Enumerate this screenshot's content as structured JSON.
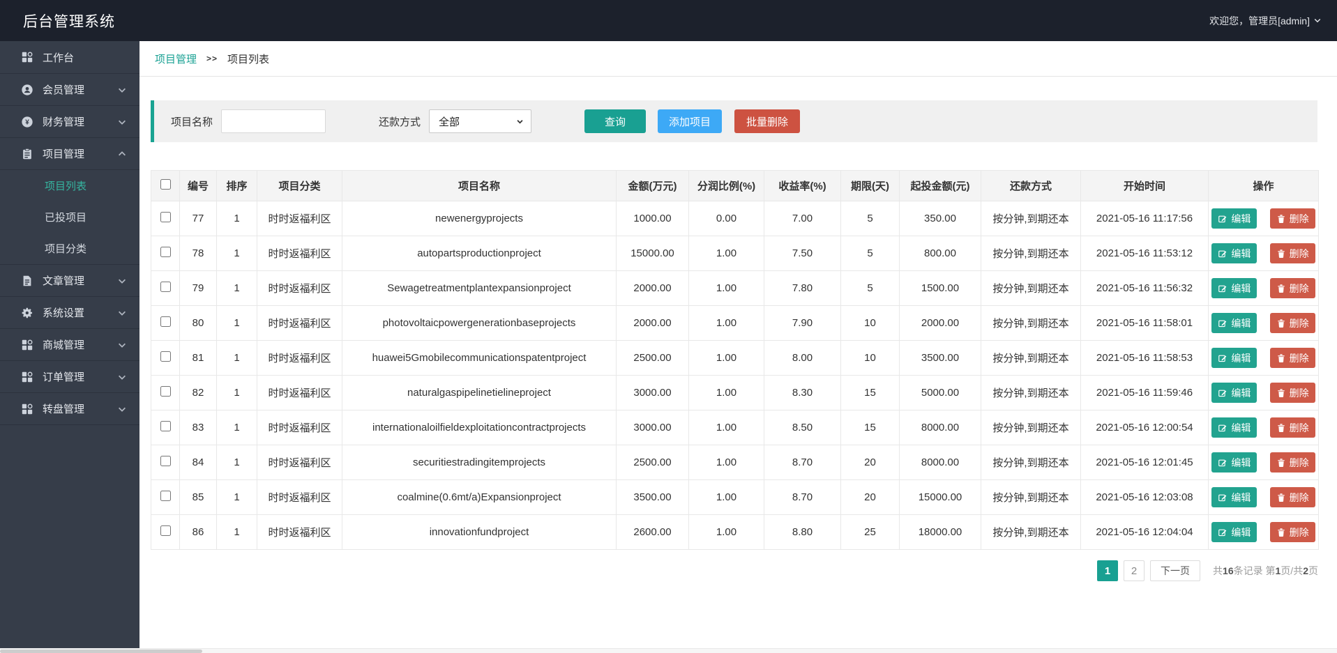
{
  "app": {
    "title": "后台管理系统",
    "welcome": "欢迎您，管理员[admin]"
  },
  "colors": {
    "accent_teal": "#19a092",
    "button_blue": "#3da9f6",
    "button_red": "#cd5241",
    "edit_teal": "#22a38f",
    "delete_red": "#ce5a48",
    "topbar": "#1c212c",
    "sidebar": "#363d49",
    "active_menu": "#35b5a0"
  },
  "sidebar": {
    "items": [
      {
        "label": "工作台",
        "icon": "dashboard-icon"
      },
      {
        "label": "会员管理",
        "icon": "member-icon"
      },
      {
        "label": "财务管理",
        "icon": "finance-icon"
      },
      {
        "label": "项目管理",
        "icon": "project-icon",
        "expanded": true,
        "children": [
          {
            "label": "项目列表",
            "active": true
          },
          {
            "label": "已投项目"
          },
          {
            "label": "项目分类"
          }
        ]
      },
      {
        "label": "文章管理",
        "icon": "article-icon"
      },
      {
        "label": "系统设置",
        "icon": "settings-icon"
      },
      {
        "label": "商城管理",
        "icon": "mall-icon"
      },
      {
        "label": "订单管理",
        "icon": "order-icon"
      },
      {
        "label": "转盘管理",
        "icon": "wheel-icon"
      }
    ]
  },
  "breadcrumb": {
    "parent": "项目管理",
    "separator": ">>",
    "current": "项目列表"
  },
  "filters": {
    "name_label": "项目名称",
    "name_value": "",
    "repay_label": "还款方式",
    "repay_value": "全部",
    "search_label": "查询",
    "add_label": "添加项目",
    "bulk_delete_label": "批量删除"
  },
  "table": {
    "headers": [
      "编号",
      "排序",
      "项目分类",
      "项目名称",
      "金额(万元)",
      "分润比例(%)",
      "收益率(%)",
      "期限(天)",
      "起投金额(元)",
      "还款方式",
      "开始时间",
      "操作"
    ],
    "actions": {
      "edit": "编辑",
      "delete": "删除"
    },
    "rows": [
      {
        "id": "77",
        "sort": "1",
        "category": "时时返福利区",
        "name": "newenergyprojects",
        "amount": "1000.00",
        "share": "0.00",
        "rate": "7.00",
        "days": "5",
        "min": "350.00",
        "repay": "按分钟,到期还本",
        "start": "2021-05-16 11:17:56"
      },
      {
        "id": "78",
        "sort": "1",
        "category": "时时返福利区",
        "name": "autopartsproductionproject",
        "amount": "15000.00",
        "share": "1.00",
        "rate": "7.50",
        "days": "5",
        "min": "800.00",
        "repay": "按分钟,到期还本",
        "start": "2021-05-16 11:53:12"
      },
      {
        "id": "79",
        "sort": "1",
        "category": "时时返福利区",
        "name": "Sewagetreatmentplantexpansionproject",
        "amount": "2000.00",
        "share": "1.00",
        "rate": "7.80",
        "days": "5",
        "min": "1500.00",
        "repay": "按分钟,到期还本",
        "start": "2021-05-16 11:56:32"
      },
      {
        "id": "80",
        "sort": "1",
        "category": "时时返福利区",
        "name": "photovoltaicpowergenerationbaseprojects",
        "amount": "2000.00",
        "share": "1.00",
        "rate": "7.90",
        "days": "10",
        "min": "2000.00",
        "repay": "按分钟,到期还本",
        "start": "2021-05-16 11:58:01"
      },
      {
        "id": "81",
        "sort": "1",
        "category": "时时返福利区",
        "name": "huawei5Gmobilecommunicationspatentproject",
        "amount": "2500.00",
        "share": "1.00",
        "rate": "8.00",
        "days": "10",
        "min": "3500.00",
        "repay": "按分钟,到期还本",
        "start": "2021-05-16 11:58:53"
      },
      {
        "id": "82",
        "sort": "1",
        "category": "时时返福利区",
        "name": "naturalgaspipelinetielineproject",
        "amount": "3000.00",
        "share": "1.00",
        "rate": "8.30",
        "days": "15",
        "min": "5000.00",
        "repay": "按分钟,到期还本",
        "start": "2021-05-16 11:59:46"
      },
      {
        "id": "83",
        "sort": "1",
        "category": "时时返福利区",
        "name": "internationaloilfieldexploitationcontractprojects",
        "amount": "3000.00",
        "share": "1.00",
        "rate": "8.50",
        "days": "15",
        "min": "8000.00",
        "repay": "按分钟,到期还本",
        "start": "2021-05-16 12:00:54"
      },
      {
        "id": "84",
        "sort": "1",
        "category": "时时返福利区",
        "name": "securitiestradingitemprojects",
        "amount": "2500.00",
        "share": "1.00",
        "rate": "8.70",
        "days": "20",
        "min": "8000.00",
        "repay": "按分钟,到期还本",
        "start": "2021-05-16 12:01:45"
      },
      {
        "id": "85",
        "sort": "1",
        "category": "时时返福利区",
        "name": "coalmine(0.6mt/a)Expansionproject",
        "amount": "3500.00",
        "share": "1.00",
        "rate": "8.70",
        "days": "20",
        "min": "15000.00",
        "repay": "按分钟,到期还本",
        "start": "2021-05-16 12:03:08"
      },
      {
        "id": "86",
        "sort": "1",
        "category": "时时返福利区",
        "name": "innovationfundproject",
        "amount": "2600.00",
        "share": "1.00",
        "rate": "8.80",
        "days": "25",
        "min": "18000.00",
        "repay": "按分钟,到期还本",
        "start": "2021-05-16 12:04:04"
      }
    ]
  },
  "pagination": {
    "page1": "1",
    "page2": "2",
    "next_label": "下一页",
    "summary": {
      "s1": "共",
      "n1": "16",
      "s2": "条记录 第",
      "n2": "1",
      "s3": "页/共",
      "n3": "2",
      "s4": "页"
    }
  }
}
